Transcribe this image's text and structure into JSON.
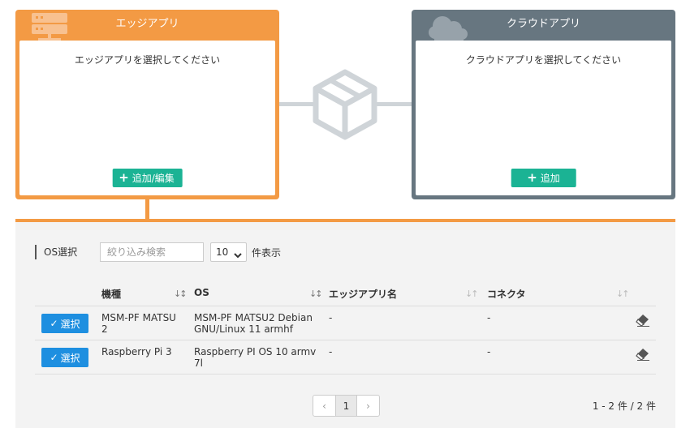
{
  "edge_card": {
    "title": "エッジアプリ",
    "placeholder": "エッジアプリを選択してください",
    "button_label": "追加/編集"
  },
  "cloud_card": {
    "title": "クラウドアプリ",
    "placeholder": "クラウドアプリを選択してください",
    "button_label": "追加"
  },
  "colors": {
    "edge": "#f39a44",
    "cloud": "#677680",
    "add_button": "#1bb394",
    "select_button": "#1e8fe0"
  },
  "os_panel": {
    "label": "OS選択",
    "filter_placeholder": "絞り込み検索",
    "page_size": "10",
    "page_size_suffix": "件表示",
    "columns": [
      "機種",
      "OS",
      "エッジアプリ名",
      "コネクタ"
    ],
    "select_label": "選択",
    "rows": [
      {
        "model": "MSM-PF MATSU 2",
        "os": "MSM-PF MATSU2 Debian GNU/Linux 11 armhf",
        "edge_app": "-",
        "connector": "-"
      },
      {
        "model": "Raspberry Pi 3",
        "os": "Raspberry PI OS 10 armv 7l",
        "edge_app": "-",
        "connector": "-"
      }
    ],
    "pagination": {
      "prev": "‹",
      "current": "1",
      "next": "›"
    },
    "count": "1 - 2 件 / 2 件"
  }
}
